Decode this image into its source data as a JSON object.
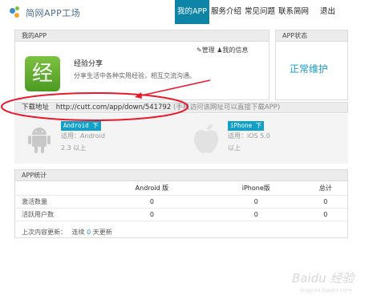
{
  "header": {
    "logo_text": "简网APP工场",
    "nav": [
      "我的APP",
      "服务介绍",
      "常见问题",
      "联系简网",
      "退出"
    ]
  },
  "myapp": {
    "title": "我的APP",
    "app_name": "经验分享",
    "app_icon_char": "经",
    "description": "分享生活中各种实用经验，相互交流沟通。",
    "manage_label": "管理",
    "info_label": "我的信息"
  },
  "status": {
    "title": "APP状态",
    "value": "正常维护"
  },
  "download": {
    "label": "下载地址",
    "url": "http://cutt.com/app/down/541792",
    "hint": "(手机访问该网址可以直接下载APP)"
  },
  "platforms": {
    "android": {
      "button": "Android 下",
      "line1": "适用：Android",
      "line2": "2.3 以上"
    },
    "ios": {
      "button": "iPhone 下",
      "line1": "适用：iOS 5.0",
      "line2": "以上"
    }
  },
  "stats": {
    "title": "APP统计",
    "columns": [
      "",
      "Android 版",
      "iPhone版",
      "总计"
    ],
    "rows": [
      {
        "label": "激活数量",
        "values": [
          "0",
          "0",
          "0"
        ]
      },
      {
        "label": "活跃用户数",
        "values": [
          "0",
          "0",
          "0"
        ]
      }
    ],
    "last_update_label": "上次内容更新：",
    "last_update_prefix": "连续",
    "last_update_days": "0",
    "last_update_suffix": "天更新"
  },
  "watermark": {
    "brand": "Baidu 经验",
    "sub": "jingyan.baidu.com"
  },
  "colors": {
    "accent": "#0e84a6",
    "status": "#1a9bc4",
    "annotation": "#e8192c"
  }
}
